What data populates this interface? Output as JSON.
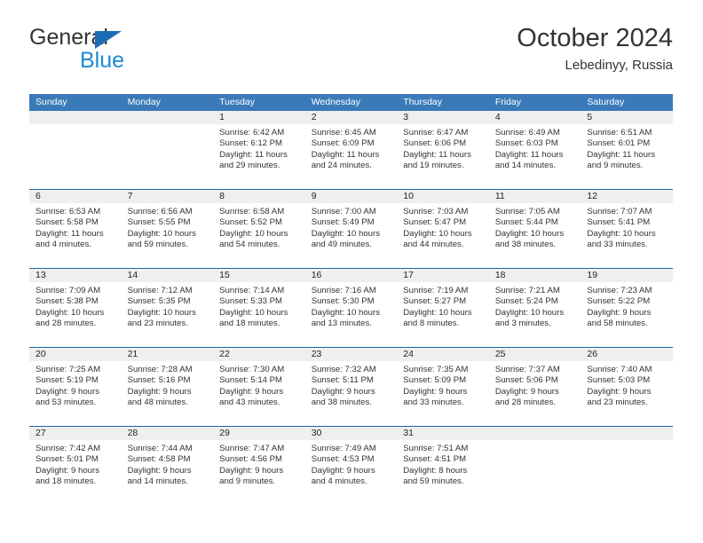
{
  "brand": {
    "name_part1": "General",
    "name_part2": "Blue",
    "triangle_icon": "triangle-logo-icon",
    "colors": {
      "general_text": "#333333",
      "blue_text": "#1c8ad6",
      "triangle": "#1c6cb5"
    }
  },
  "header": {
    "title": "October 2024",
    "subtitle": "Lebedinyy, Russia"
  },
  "theme": {
    "header_row_blue": "#3a7ab8",
    "row_separator_blue": "#1f63a6",
    "date_band_gray": "#efefef"
  },
  "weekday_headers": [
    "Sunday",
    "Monday",
    "Tuesday",
    "Wednesday",
    "Thursday",
    "Friday",
    "Saturday"
  ],
  "weeks": [
    [
      {
        "empty": true
      },
      {
        "empty": true
      },
      {
        "day": "1",
        "sunrise": "Sunrise: 6:42 AM",
        "sunset": "Sunset: 6:12 PM",
        "daylight_line1": "Daylight: 11 hours",
        "daylight_line2": "and 29 minutes."
      },
      {
        "day": "2",
        "sunrise": "Sunrise: 6:45 AM",
        "sunset": "Sunset: 6:09 PM",
        "daylight_line1": "Daylight: 11 hours",
        "daylight_line2": "and 24 minutes."
      },
      {
        "day": "3",
        "sunrise": "Sunrise: 6:47 AM",
        "sunset": "Sunset: 6:06 PM",
        "daylight_line1": "Daylight: 11 hours",
        "daylight_line2": "and 19 minutes."
      },
      {
        "day": "4",
        "sunrise": "Sunrise: 6:49 AM",
        "sunset": "Sunset: 6:03 PM",
        "daylight_line1": "Daylight: 11 hours",
        "daylight_line2": "and 14 minutes."
      },
      {
        "day": "5",
        "sunrise": "Sunrise: 6:51 AM",
        "sunset": "Sunset: 6:01 PM",
        "daylight_line1": "Daylight: 11 hours",
        "daylight_line2": "and 9 minutes."
      }
    ],
    [
      {
        "day": "6",
        "sunrise": "Sunrise: 6:53 AM",
        "sunset": "Sunset: 5:58 PM",
        "daylight_line1": "Daylight: 11 hours",
        "daylight_line2": "and 4 minutes."
      },
      {
        "day": "7",
        "sunrise": "Sunrise: 6:56 AM",
        "sunset": "Sunset: 5:55 PM",
        "daylight_line1": "Daylight: 10 hours",
        "daylight_line2": "and 59 minutes."
      },
      {
        "day": "8",
        "sunrise": "Sunrise: 6:58 AM",
        "sunset": "Sunset: 5:52 PM",
        "daylight_line1": "Daylight: 10 hours",
        "daylight_line2": "and 54 minutes."
      },
      {
        "day": "9",
        "sunrise": "Sunrise: 7:00 AM",
        "sunset": "Sunset: 5:49 PM",
        "daylight_line1": "Daylight: 10 hours",
        "daylight_line2": "and 49 minutes."
      },
      {
        "day": "10",
        "sunrise": "Sunrise: 7:03 AM",
        "sunset": "Sunset: 5:47 PM",
        "daylight_line1": "Daylight: 10 hours",
        "daylight_line2": "and 44 minutes."
      },
      {
        "day": "11",
        "sunrise": "Sunrise: 7:05 AM",
        "sunset": "Sunset: 5:44 PM",
        "daylight_line1": "Daylight: 10 hours",
        "daylight_line2": "and 38 minutes."
      },
      {
        "day": "12",
        "sunrise": "Sunrise: 7:07 AM",
        "sunset": "Sunset: 5:41 PM",
        "daylight_line1": "Daylight: 10 hours",
        "daylight_line2": "and 33 minutes."
      }
    ],
    [
      {
        "day": "13",
        "sunrise": "Sunrise: 7:09 AM",
        "sunset": "Sunset: 5:38 PM",
        "daylight_line1": "Daylight: 10 hours",
        "daylight_line2": "and 28 minutes."
      },
      {
        "day": "14",
        "sunrise": "Sunrise: 7:12 AM",
        "sunset": "Sunset: 5:35 PM",
        "daylight_line1": "Daylight: 10 hours",
        "daylight_line2": "and 23 minutes."
      },
      {
        "day": "15",
        "sunrise": "Sunrise: 7:14 AM",
        "sunset": "Sunset: 5:33 PM",
        "daylight_line1": "Daylight: 10 hours",
        "daylight_line2": "and 18 minutes."
      },
      {
        "day": "16",
        "sunrise": "Sunrise: 7:16 AM",
        "sunset": "Sunset: 5:30 PM",
        "daylight_line1": "Daylight: 10 hours",
        "daylight_line2": "and 13 minutes."
      },
      {
        "day": "17",
        "sunrise": "Sunrise: 7:19 AM",
        "sunset": "Sunset: 5:27 PM",
        "daylight_line1": "Daylight: 10 hours",
        "daylight_line2": "and 8 minutes."
      },
      {
        "day": "18",
        "sunrise": "Sunrise: 7:21 AM",
        "sunset": "Sunset: 5:24 PM",
        "daylight_line1": "Daylight: 10 hours",
        "daylight_line2": "and 3 minutes."
      },
      {
        "day": "19",
        "sunrise": "Sunrise: 7:23 AM",
        "sunset": "Sunset: 5:22 PM",
        "daylight_line1": "Daylight: 9 hours",
        "daylight_line2": "and 58 minutes."
      }
    ],
    [
      {
        "day": "20",
        "sunrise": "Sunrise: 7:25 AM",
        "sunset": "Sunset: 5:19 PM",
        "daylight_line1": "Daylight: 9 hours",
        "daylight_line2": "and 53 minutes."
      },
      {
        "day": "21",
        "sunrise": "Sunrise: 7:28 AM",
        "sunset": "Sunset: 5:16 PM",
        "daylight_line1": "Daylight: 9 hours",
        "daylight_line2": "and 48 minutes."
      },
      {
        "day": "22",
        "sunrise": "Sunrise: 7:30 AM",
        "sunset": "Sunset: 5:14 PM",
        "daylight_line1": "Daylight: 9 hours",
        "daylight_line2": "and 43 minutes."
      },
      {
        "day": "23",
        "sunrise": "Sunrise: 7:32 AM",
        "sunset": "Sunset: 5:11 PM",
        "daylight_line1": "Daylight: 9 hours",
        "daylight_line2": "and 38 minutes."
      },
      {
        "day": "24",
        "sunrise": "Sunrise: 7:35 AM",
        "sunset": "Sunset: 5:09 PM",
        "daylight_line1": "Daylight: 9 hours",
        "daylight_line2": "and 33 minutes."
      },
      {
        "day": "25",
        "sunrise": "Sunrise: 7:37 AM",
        "sunset": "Sunset: 5:06 PM",
        "daylight_line1": "Daylight: 9 hours",
        "daylight_line2": "and 28 minutes."
      },
      {
        "day": "26",
        "sunrise": "Sunrise: 7:40 AM",
        "sunset": "Sunset: 5:03 PM",
        "daylight_line1": "Daylight: 9 hours",
        "daylight_line2": "and 23 minutes."
      }
    ],
    [
      {
        "day": "27",
        "sunrise": "Sunrise: 7:42 AM",
        "sunset": "Sunset: 5:01 PM",
        "daylight_line1": "Daylight: 9 hours",
        "daylight_line2": "and 18 minutes."
      },
      {
        "day": "28",
        "sunrise": "Sunrise: 7:44 AM",
        "sunset": "Sunset: 4:58 PM",
        "daylight_line1": "Daylight: 9 hours",
        "daylight_line2": "and 14 minutes."
      },
      {
        "day": "29",
        "sunrise": "Sunrise: 7:47 AM",
        "sunset": "Sunset: 4:56 PM",
        "daylight_line1": "Daylight: 9 hours",
        "daylight_line2": "and 9 minutes."
      },
      {
        "day": "30",
        "sunrise": "Sunrise: 7:49 AM",
        "sunset": "Sunset: 4:53 PM",
        "daylight_line1": "Daylight: 9 hours",
        "daylight_line2": "and 4 minutes."
      },
      {
        "day": "31",
        "sunrise": "Sunrise: 7:51 AM",
        "sunset": "Sunset: 4:51 PM",
        "daylight_line1": "Daylight: 8 hours",
        "daylight_line2": "and 59 minutes."
      },
      {
        "empty": true
      },
      {
        "empty": true
      }
    ]
  ]
}
